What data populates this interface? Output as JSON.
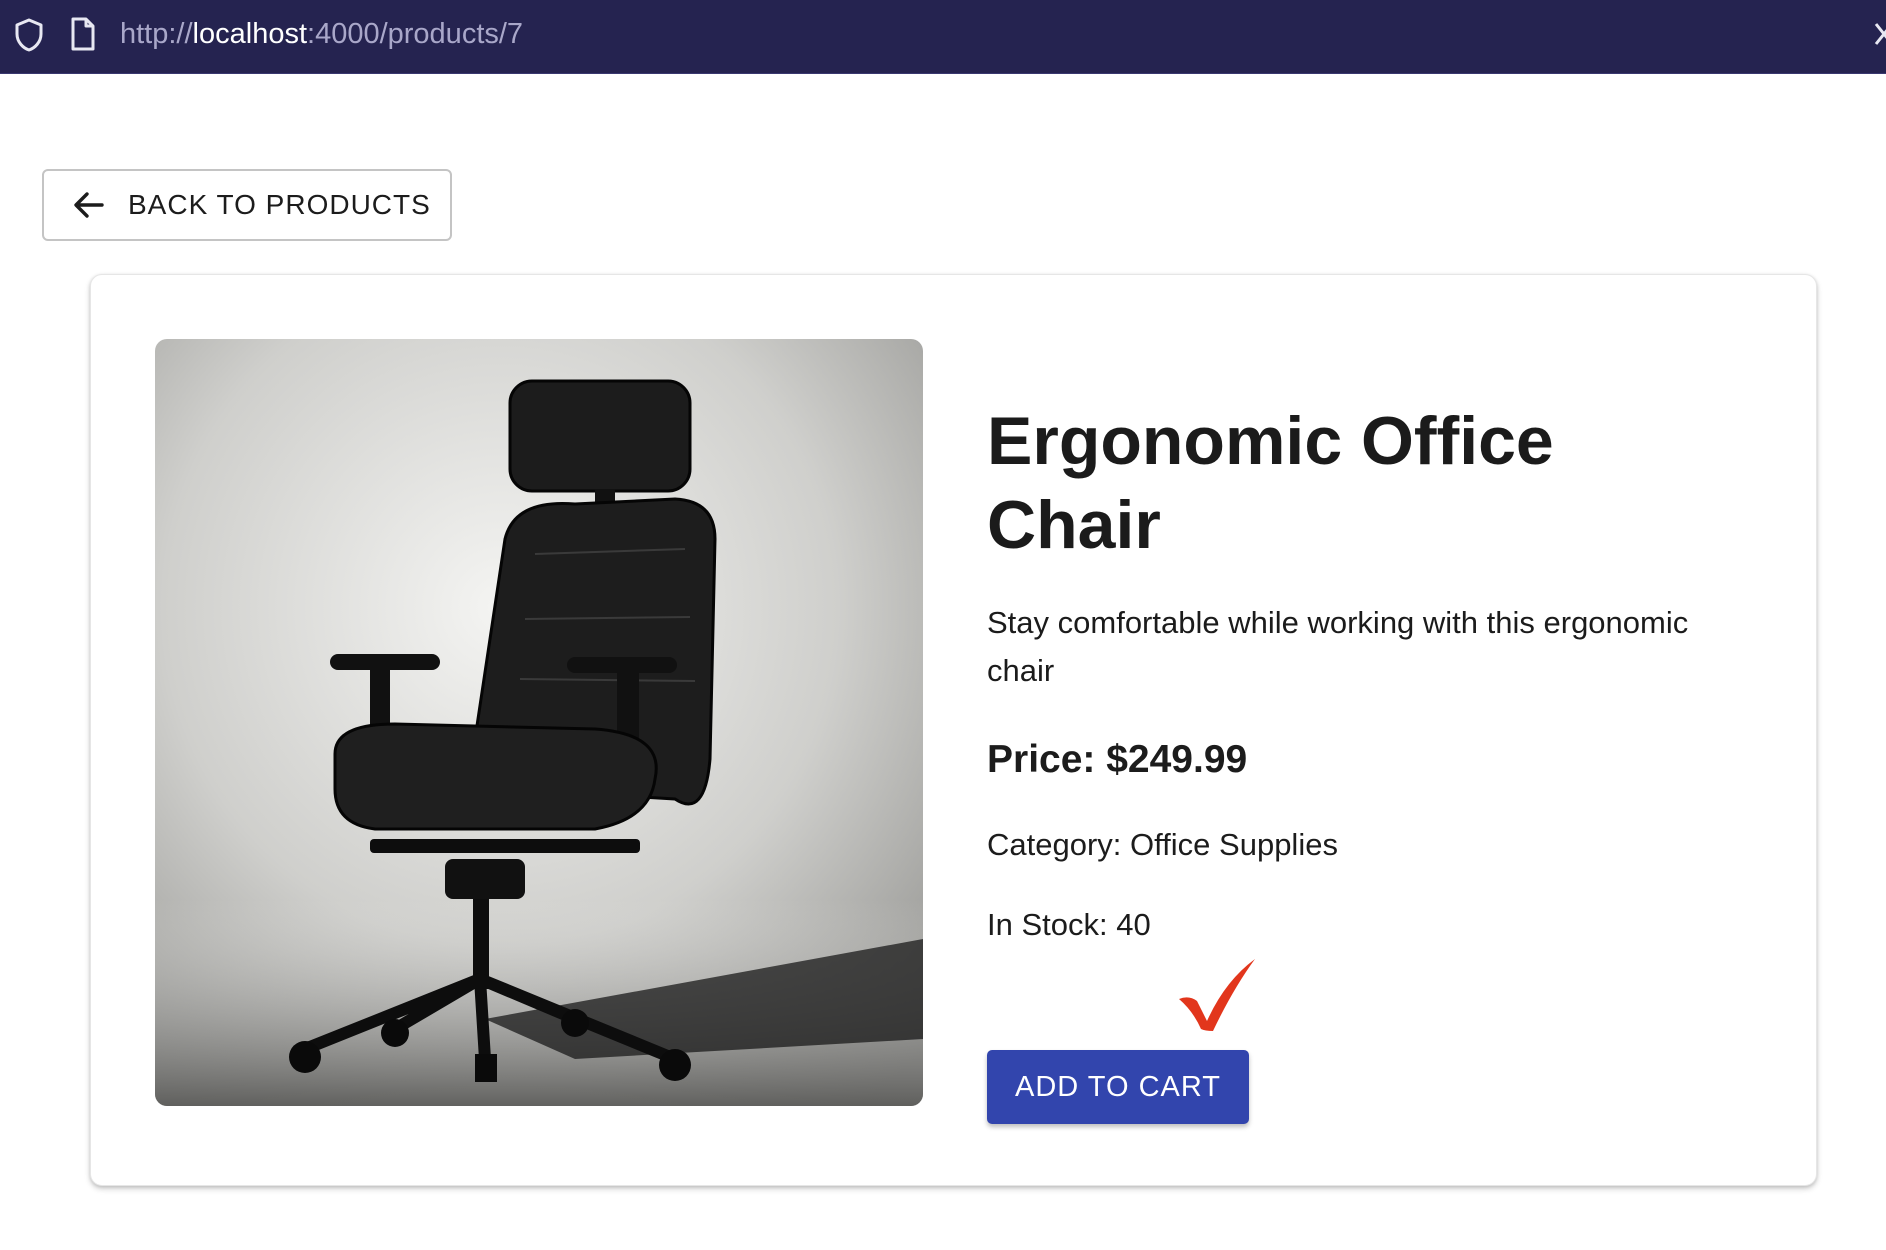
{
  "browser": {
    "url_scheme": "http://",
    "url_host": "localhost",
    "url_rest": ":4000/products/7",
    "bar_color": "#252350"
  },
  "nav": {
    "back_label": "BACK TO PRODUCTS",
    "back_icon": "arrow-left-icon"
  },
  "product": {
    "image_subject": "black ergonomic office chair",
    "title": "Ergonomic Office Chair",
    "description": "Stay comfortable while working with this ergonomic chair",
    "price": "Price: $249.99",
    "category": "Category: Office Supplies",
    "stock": "In Stock: 40"
  },
  "actions": {
    "add_to_cart_label": "ADD TO CART",
    "button_color": "#3245ad"
  },
  "annotation": {
    "icon": "checkmark-icon",
    "color": "#e2361c"
  }
}
